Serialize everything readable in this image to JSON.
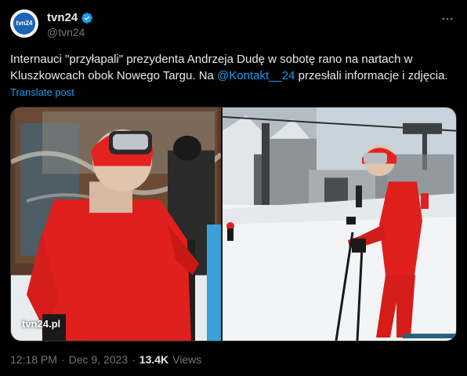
{
  "tweet": {
    "display_name": "tvn24",
    "handle": "@tvn24",
    "avatar_text": "tvn24",
    "text_before_mention": "Internauci \"przyłapali\" prezydenta Andrzeja Dudę w sobotę rano na nartach w Kluszkowcach obok Nowego Targu. Na ",
    "mention": "@Kontakt__24",
    "text_after_mention": " przesłali informacje i zdjęcia.",
    "translate_label": "Translate post",
    "time": "12:18 PM",
    "separator": "·",
    "date": "Dec 9, 2023",
    "views_count": "13.4K",
    "views_label": "Views"
  },
  "media": {
    "watermark": "tvn24.pl",
    "left_photo": "skier-portrait-photo",
    "right_photo": "ski-slope-photo"
  },
  "icons": {
    "verified": "verified-badge-icon",
    "more": "more-dots-icon"
  },
  "colors": {
    "background": "#000000",
    "text": "#e7e9ea",
    "secondary": "#71767b",
    "accent": "#1d9bf0"
  }
}
